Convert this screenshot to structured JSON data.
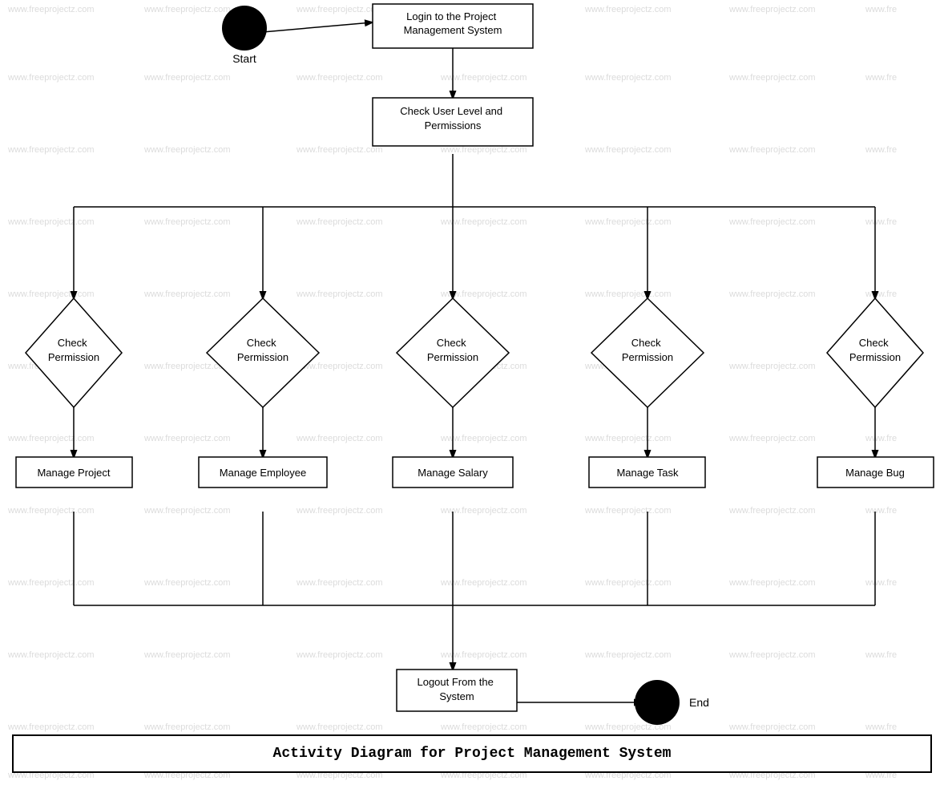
{
  "title": "Activity Diagram for Project Management System",
  "watermark": "www.freeprojectz.com",
  "nodes": {
    "start_label": "Start",
    "end_label": "End",
    "login": "Login to the Project Management System",
    "check_permissions": "Check User Level and\nPermissions",
    "check_perm1": "Check\nPermission",
    "check_perm2": "Check\nPermission",
    "check_perm3": "Check\nPermission",
    "check_perm4": "Check\nPermission",
    "check_perm5": "Check\nPermission",
    "manage_project": "Manage Project",
    "manage_employee": "Manage Employee",
    "manage_salary": "Manage Salary",
    "manage_task": "Manage Task",
    "manage_bug": "Manage Bug",
    "logout": "Logout From the\nSystem"
  },
  "colors": {
    "node_fill": "#ffffff",
    "node_stroke": "#000000",
    "text": "#000000",
    "start_end": "#000000",
    "watermark": "#cccccc"
  }
}
